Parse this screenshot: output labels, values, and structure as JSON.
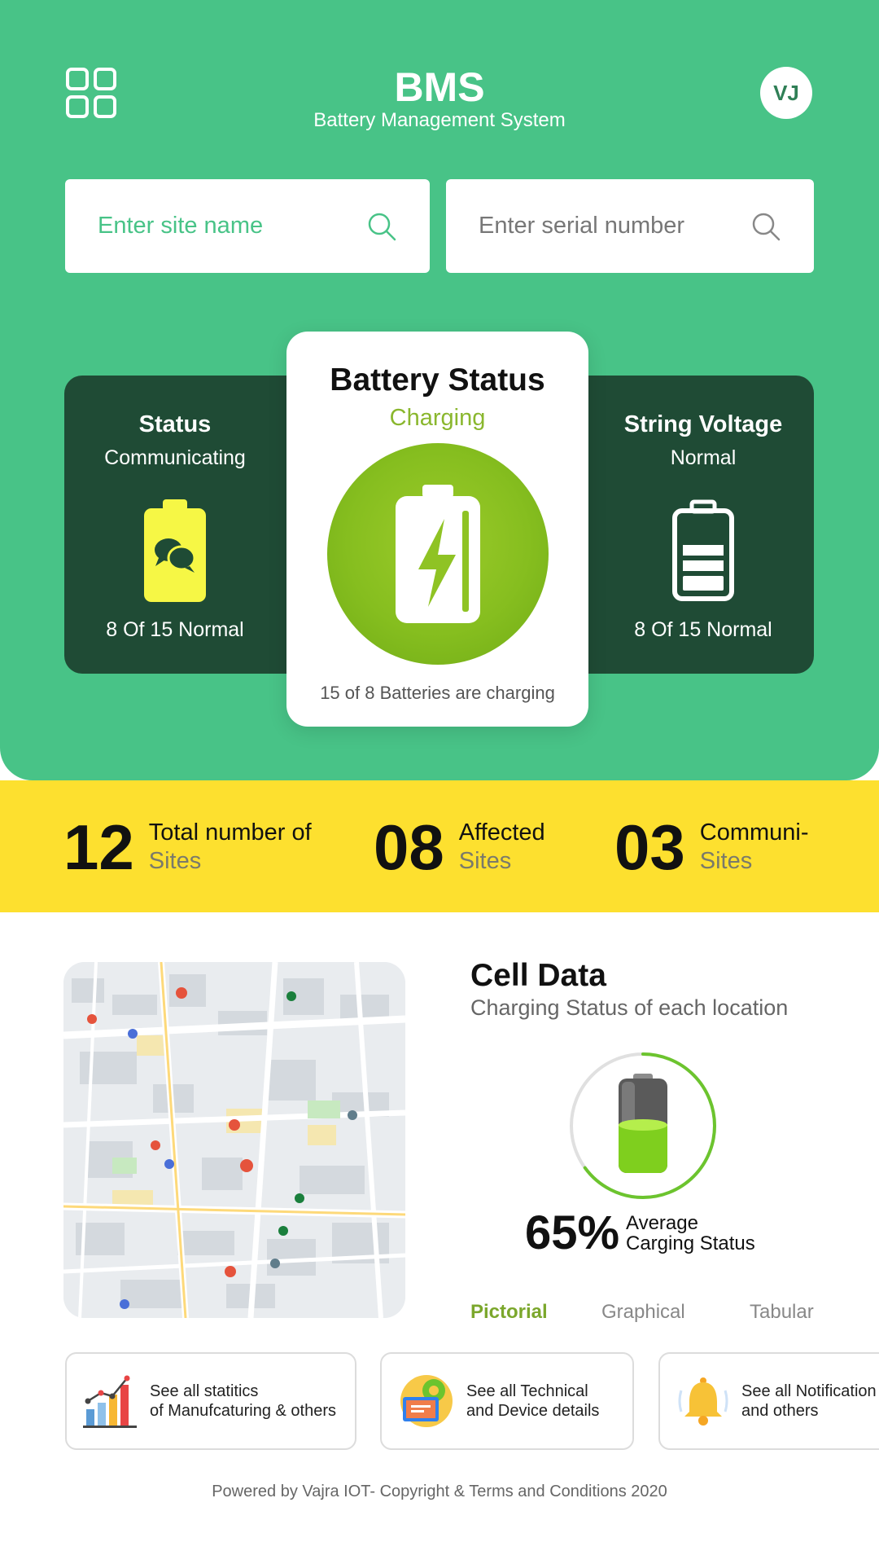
{
  "header": {
    "title": "BMS",
    "subtitle": "Battery Management System",
    "avatar_initials": "VJ",
    "background_color": "#48c387"
  },
  "search": {
    "site_placeholder": "Enter site name",
    "serial_placeholder": "Enter serial number"
  },
  "cards": {
    "status": {
      "title": "Status",
      "subtitle": "Communicating",
      "footer": "8 Of 15 Normal",
      "icon": "battery-chat-icon"
    },
    "battery_status": {
      "title": "Battery Status",
      "subtitle": "Charging",
      "footer": "15 of 8 Batteries are charging",
      "icon": "battery-charging-icon"
    },
    "string_voltage": {
      "title": "String Voltage",
      "subtitle": "Normal",
      "footer": "8 Of 15 Normal",
      "icon": "battery-level-icon"
    }
  },
  "stats": [
    {
      "value": "12",
      "line1": "Total number of",
      "line2": "Sites"
    },
    {
      "value": "08",
      "line1": "Affected",
      "line2": "Sites"
    },
    {
      "value": "03",
      "line1": "Communi-",
      "line2": "Sites"
    }
  ],
  "cell_data": {
    "title": "Cell Data",
    "subtitle": "Charging Status of each location",
    "percent_label": "65%",
    "percent_value": 65,
    "avg_line1": "Average",
    "avg_line2": "Carging Status",
    "tabs": [
      "Pictorial",
      "Graphical",
      "Tabular"
    ],
    "active_tab": "Pictorial"
  },
  "info_cards": [
    {
      "line1": "See all statitics",
      "line2": "of Manufcaturing & others",
      "icon": "bar-chart-icon"
    },
    {
      "line1": "See all Technical",
      "line2": "and Device details",
      "icon": "device-gear-icon"
    },
    {
      "line1": "See all Notification",
      "line2": "and others",
      "icon": "bell-icon"
    }
  ],
  "footer": {
    "text": "Powered by Vajra IOT- Copyright & Terms and Conditions 2020"
  },
  "colors": {
    "green": "#48c387",
    "dark_card": "#1f4b35",
    "yellow_band": "#fde02f",
    "charging_green": "#8ab72e"
  }
}
